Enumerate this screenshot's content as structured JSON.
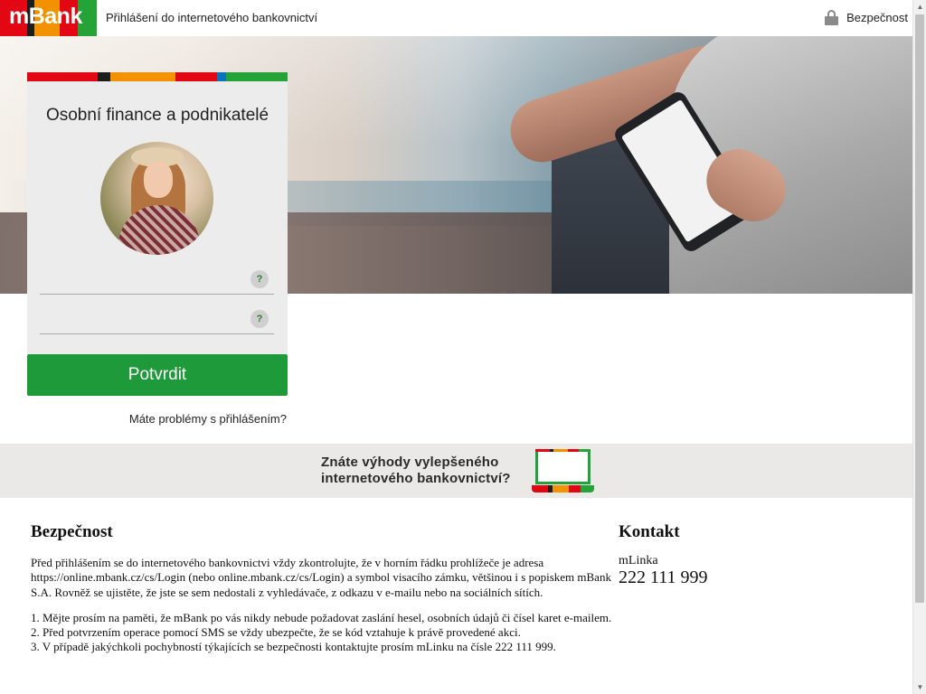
{
  "header": {
    "logo_text": "mBank",
    "title": "Přihlášení do internetového bankovnictví",
    "security_link": "Bezpečnost",
    "security_icon": "lock-icon"
  },
  "brand_colors": [
    "#e30613",
    "#1d1d1b",
    "#f39200",
    "#e30613",
    "#0a74bb",
    "#26a337"
  ],
  "login": {
    "title": "Osobní finance a podnikatelé",
    "username_value": "",
    "password_value": "",
    "help_symbol": "?",
    "submit_label": "Potvrdit",
    "trouble_link": "Máte problémy s přihlášením?"
  },
  "banner": {
    "line1": "Znáte výhody vylepšeného",
    "line2": "internetového bankovnictví?",
    "icon": "laptop-icon"
  },
  "security": {
    "heading": "Bezpečnost",
    "paragraph": "Před přihlášením se do internetového bankovnictvi vždy zkontrolujte, že v horním řádku prohlížeče je adresa https://online.mbank.cz/cs/Login (nebo online.mbank.cz/cs/Login) a symbol visacího zámku, většinou i s popiskem mBank S.A. Rovněž se ujistěte, že jste se sem nedostali z vyhledávače, z odkazu v e-mailu nebo na sociálních sítích.",
    "items": [
      "1. Mějte prosím na paměti, že mBank po vás nikdy nebude požadovat zaslání hesel, osobních údajů či čísel karet e-mailem.",
      "2. Před potvrzením operace pomocí SMS se vždy ubezpečte, že se kód vztahuje k právě provedené akci.",
      "3. V případě jakýchkoli pochybností týkajících se bezpečnosti kontaktujte prosím mLinku na čísle 222 111 999."
    ]
  },
  "contact": {
    "heading": "Kontakt",
    "label": "mLinka",
    "phone": "222 111 999"
  }
}
